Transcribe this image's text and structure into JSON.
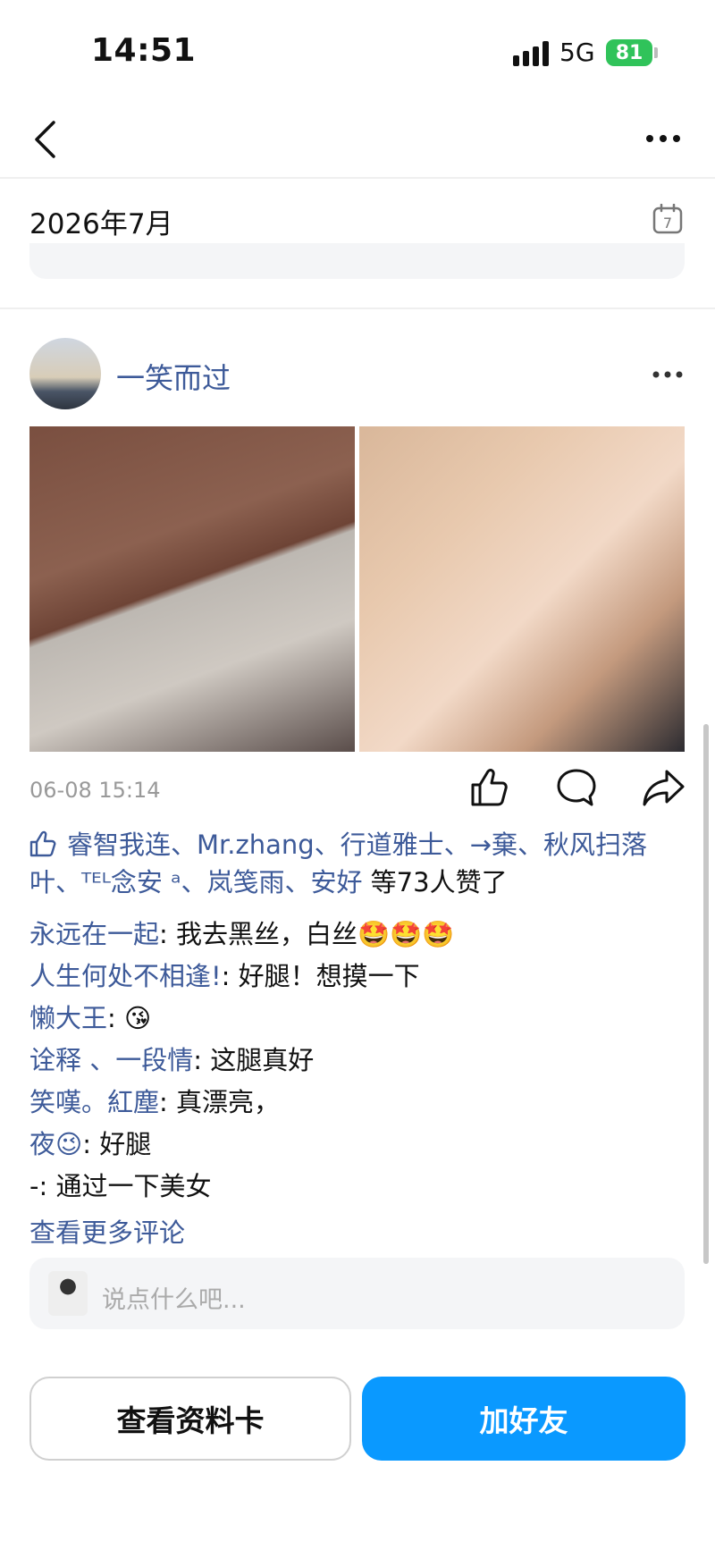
{
  "status_bar": {
    "time": "14:51",
    "network": "5G",
    "battery": "81"
  },
  "header": {
    "month": "2026年7月",
    "calendar_day": "7"
  },
  "post": {
    "username": "一笑而过",
    "timestamp": "06-08 15:14",
    "likes_names": "睿智我连、Mr.zhang、行道雅士、→棄、秋风扫落叶、ᵀᴱᴸ念安 ᵃ、岚笺雨、安好",
    "likes_tail": " 等73人赞了",
    "comments": [
      {
        "name": "永远在一起",
        "text": ": 我去黑丝，白丝🤩🤩🤩"
      },
      {
        "name": "人生何处不相逢!",
        "text": ": 好腿！想摸一下"
      },
      {
        "name": "懒大王",
        "text": ": 😘"
      },
      {
        "name": "诠释 、一段情",
        "text": ": 这腿真好"
      },
      {
        "name": "笑嘆。紅塵",
        "text": ": 真漂亮，"
      },
      {
        "name": "夜😉",
        "text": ": 好腿"
      },
      {
        "name": "-",
        "text": ": 通过一下美女"
      }
    ],
    "more_comments": "查看更多评论",
    "comment_placeholder": "说点什么吧..."
  },
  "buttons": {
    "view_card": "查看资料卡",
    "add_friend": "加好友"
  },
  "colors": {
    "link": "#3d5a99",
    "primary": "#0a99ff",
    "battery": "#30c35a"
  }
}
